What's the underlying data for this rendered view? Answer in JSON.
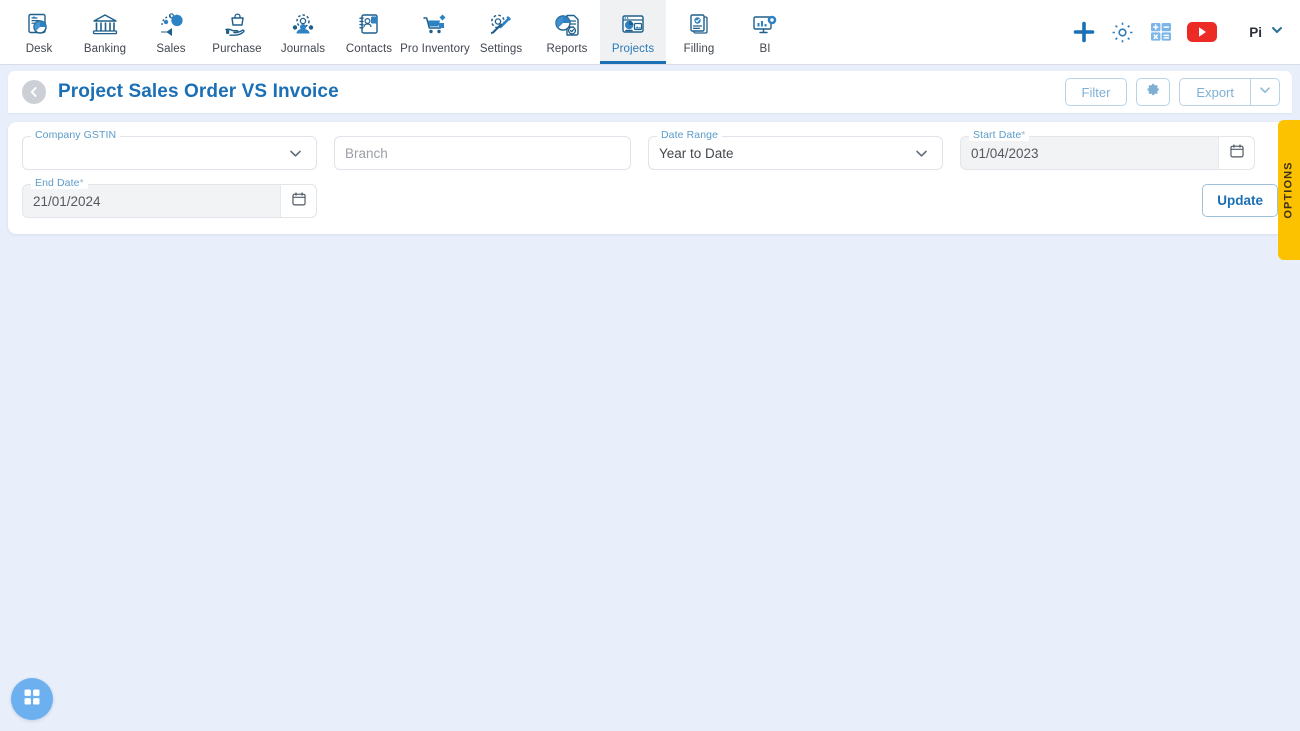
{
  "topnav": {
    "items": [
      {
        "label": "Desk",
        "icon": "desk-dashboard-icon",
        "active": false
      },
      {
        "label": "Banking",
        "icon": "bank-building-icon",
        "active": false
      },
      {
        "label": "Sales",
        "icon": "sales-megaphone-icon",
        "active": false
      },
      {
        "label": "Purchase",
        "icon": "purchase-bag-hand-icon",
        "active": false
      },
      {
        "label": "Journals",
        "icon": "journals-gear-people-icon",
        "active": false
      },
      {
        "label": "Contacts",
        "icon": "contacts-book-icon",
        "active": false
      },
      {
        "label": "Pro Inventory",
        "icon": "inventory-cart-icon",
        "active": false
      },
      {
        "label": "Settings",
        "icon": "settings-tools-icon",
        "active": false
      },
      {
        "label": "Reports",
        "icon": "reports-piechart-icon",
        "active": false
      },
      {
        "label": "Projects",
        "icon": "projects-window-icon",
        "active": true
      },
      {
        "label": "Filling",
        "icon": "filling-documents-icon",
        "active": false
      },
      {
        "label": "BI",
        "icon": "bi-monitor-icon",
        "active": false
      }
    ],
    "actions": [
      {
        "name": "add-icon",
        "title": "Add"
      },
      {
        "name": "gear-icon",
        "title": "Settings"
      },
      {
        "name": "calculator-icon",
        "title": "Calculator"
      },
      {
        "name": "youtube-icon",
        "title": "YouTube"
      }
    ],
    "user": {
      "name": "Pi",
      "caret": "chevron-down-icon"
    }
  },
  "header": {
    "back_icon": "back-arrow-icon",
    "title": "Project Sales Order VS Invoice",
    "buttons": {
      "filter": "Filter",
      "settings_icon": "gear-icon",
      "export": "Export",
      "export_caret": "chevron-down-icon"
    }
  },
  "filters": {
    "company_gstin": {
      "label": "Company GSTIN",
      "value": "",
      "placeholder": ""
    },
    "branch": {
      "label": "",
      "value": "",
      "placeholder": "Branch"
    },
    "date_range": {
      "label": "Date Range",
      "value": "Year to Date"
    },
    "start_date": {
      "label": "Start Date",
      "required": "*",
      "value": "01/04/2023"
    },
    "end_date": {
      "label": "End Date",
      "required": "*",
      "value": "21/01/2024"
    },
    "update_button": "Update"
  },
  "options_tab": {
    "label": "OPTIONS"
  },
  "fab": {
    "icon": "grid-apps-icon"
  },
  "colors": {
    "accent_blue": "#1a6fb5",
    "page_bg": "#e9eefb",
    "options_yellow": "#fcc200",
    "youtube_red": "#ec2b26",
    "fab_blue": "#6cb0ef"
  }
}
